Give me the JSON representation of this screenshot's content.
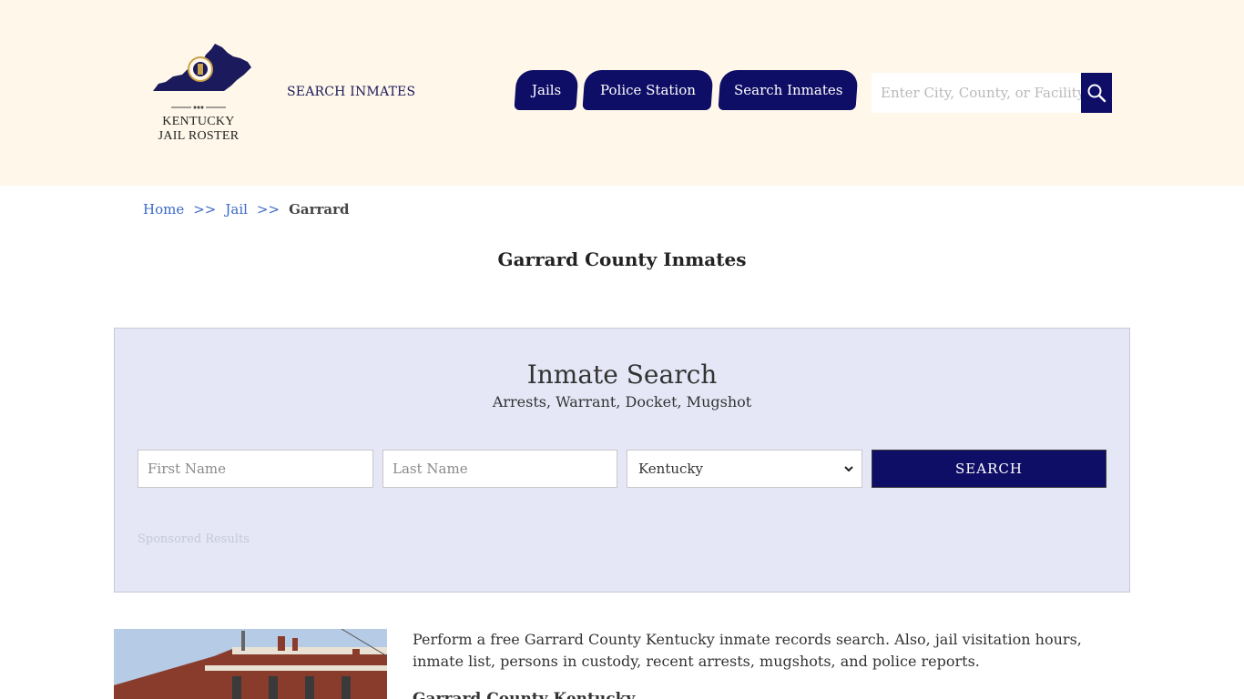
{
  "header": {
    "logo_line1": "KENTUCKY",
    "logo_line2": "JAIL ROSTER",
    "site_link": "SEARCH INMATES",
    "nav": [
      {
        "label": "Jails"
      },
      {
        "label": "Police Station"
      },
      {
        "label": "Search Inmates"
      }
    ],
    "search_placeholder": "Enter City, County, or Facility",
    "search_icon": "search-icon",
    "colors": {
      "header_bg": "#fff8ea",
      "navy": "#0f0e66",
      "link": "#3a68c9",
      "panel_bg": "#e5e7f6"
    }
  },
  "breadcrumb": {
    "home": "Home",
    "sep1": ">>",
    "jail": "Jail",
    "sep2": ">>",
    "current": "Garrard"
  },
  "page_title": "Garrard County Inmates",
  "search_panel": {
    "title": "Inmate Search",
    "subtitle": "Arrests, Warrant, Docket, Mugshot",
    "first_name_placeholder": "First Name",
    "last_name_placeholder": "Last Name",
    "state_selected": "Kentucky",
    "search_label": "SEARCH",
    "sponsored": "Sponsored Results"
  },
  "content": {
    "intro": "Perform a free Garrard County Kentucky inmate records search. Also, jail visitation hours, inmate list, persons in custody, recent arrests, mugshots, and police reports.",
    "subheading": "Garrard County Kentucky"
  }
}
